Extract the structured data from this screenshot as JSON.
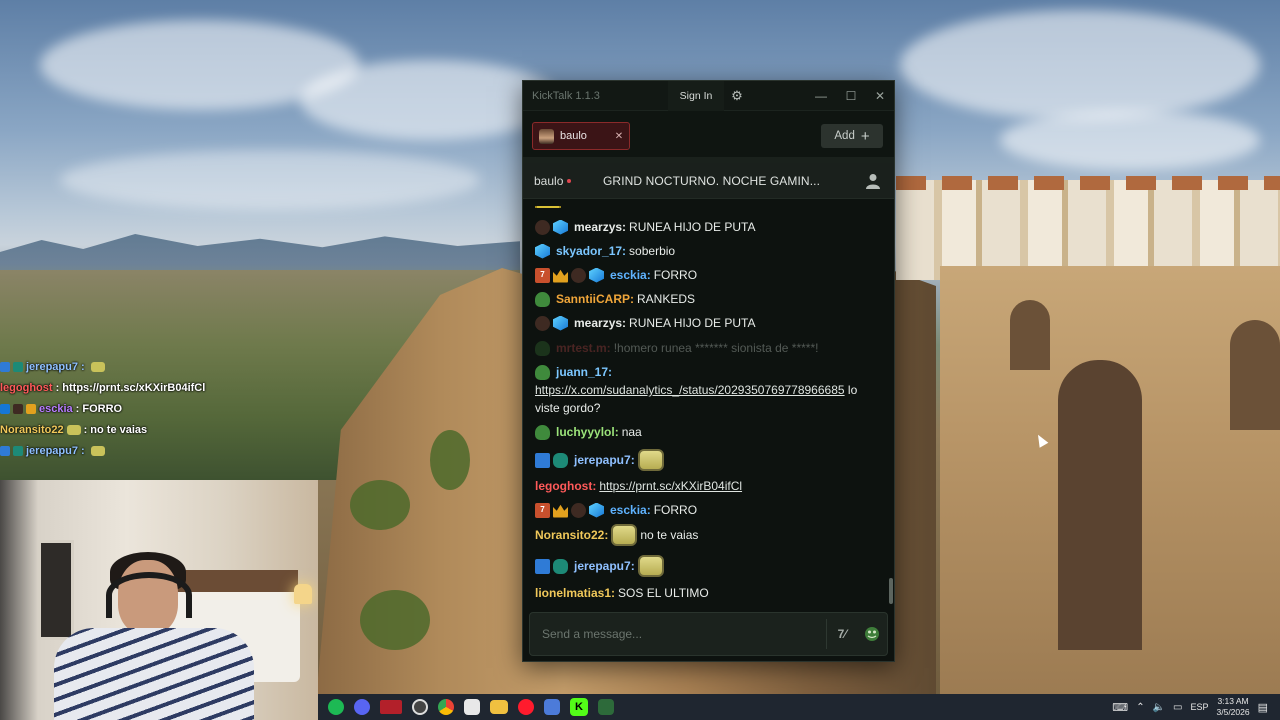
{
  "app": {
    "title": "KickTalk 1.1.3",
    "sign_in_label": "Sign In",
    "add_label": "Add",
    "tab_label": "baulo",
    "channel_name": "baulo",
    "stream_title": "GRIND NOCTURNO. NOCHE GAMIN...",
    "input_placeholder": "Send a message..."
  },
  "messages": [
    {
      "user": "mearzys:",
      "text": "RUNEA HIJO DE PUTA",
      "color": "#e8ece9",
      "badges": [
        "ninja",
        "cube"
      ]
    },
    {
      "user": "skyador_17:",
      "text": "soberbio",
      "color": "#7cc7ff",
      "badges": [
        "cube"
      ]
    },
    {
      "user": "esckia:",
      "text": "FORRO",
      "color": "#5fb3ff",
      "badges": [
        "num",
        "crown",
        "ninja",
        "cube"
      ]
    },
    {
      "user": "SanntiiCARP:",
      "text": "RANKEDS",
      "color": "#f0a63a",
      "badges": [
        "frog"
      ]
    },
    {
      "user": "mearzys:",
      "text": "RUNEA HIJO DE PUTA",
      "color": "#e8ece9",
      "badges": [
        "ninja",
        "cube"
      ]
    },
    {
      "user": "mrtest.m:",
      "text": "!homero runea ******* sionista de *****!",
      "color": "#7a3333",
      "badges": [
        "frog"
      ],
      "deleted": true
    },
    {
      "user": "juann_17:",
      "link": "https://x.com/sudanalytics_/status/2029350769778966685",
      "text": "lo viste gordo?",
      "color": "#7cc7ff",
      "badges": [
        "frog"
      ]
    },
    {
      "user": "luchyyylol:",
      "text": "naa",
      "color": "#9be37a",
      "badges": [
        "frog"
      ]
    },
    {
      "user": "jerepapu7:",
      "text": "",
      "color": "#8fc0ff",
      "badges": [
        "hammer",
        "snake"
      ],
      "emote": true
    },
    {
      "user": "legoghost:",
      "link": "https://prnt.sc/xKXirB04ifCl",
      "text": "",
      "color": "#ff5a5a",
      "badges": []
    },
    {
      "user": "esckia:",
      "text": "FORRO",
      "color": "#5fb3ff",
      "badges": [
        "num",
        "crown",
        "ninja",
        "cube"
      ]
    },
    {
      "user": "Noransito22:",
      "text": "no te vaias",
      "color": "#f0c85a",
      "badges": [],
      "emote": true
    },
    {
      "user": "jerepapu7:",
      "text": "",
      "color": "#8fc0ff",
      "badges": [
        "hammer",
        "snake"
      ],
      "emote": true
    },
    {
      "user": "lionelmatias1:",
      "text": "SOS EL ULTIMO",
      "color": "#f0c85a",
      "badges": []
    }
  ],
  "overlay_chat": [
    {
      "user": "jerepapu7 :",
      "text": "",
      "color": "#8fc0ff"
    },
    {
      "user": "legoghost",
      "text": ": https://prnt.sc/xKXirB04ifCl",
      "color": "#ff5a5a"
    },
    {
      "user": "esckia",
      "text": ": FORRO",
      "color": "#b77cff"
    },
    {
      "user": "Noransito22",
      "text": ": no te vaias",
      "color": "#f0c85a"
    },
    {
      "user": "jerepapu7 :",
      "text": "",
      "color": "#8fc0ff"
    }
  ],
  "taskbar": {
    "lang": "ESP",
    "time": "3:13 AM",
    "date": "3/5/2026"
  },
  "colors": {
    "accent_red": "#8b2a2a",
    "window_bg": "#0d120f"
  }
}
